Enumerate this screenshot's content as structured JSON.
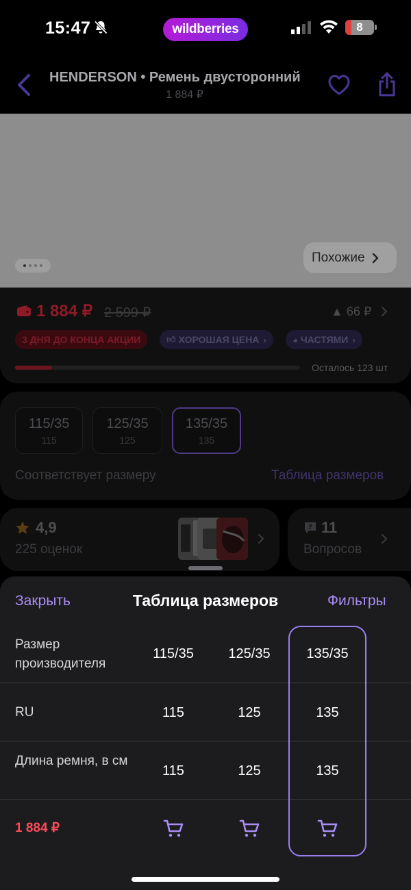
{
  "status_bar": {
    "time": "15:47",
    "brand": "wildberries",
    "battery": "8"
  },
  "header": {
    "title": "HENDERSON • Ремень двусторонний",
    "price": "1 884 ₽"
  },
  "gallery": {
    "similar_label": "Похожие",
    "current_photo": 1,
    "photo_count": 4
  },
  "price": {
    "current": "1 884 ₽",
    "old": "2 599 ₽",
    "change": "▲ 66 ₽",
    "badges": {
      "promo": "3 ДНЯ ДО КОНЦА АКЦИИ",
      "good_price": "ХОРОШАЯ ЦЕНА",
      "installments": "ЧАСТЯМИ"
    },
    "stock_label": "Осталось 123 шт",
    "stock_fraction": 0.13
  },
  "sizes": {
    "options": [
      {
        "name": "115/35",
        "ru": "115"
      },
      {
        "name": "125/35",
        "ru": "125"
      },
      {
        "name": "135/35",
        "ru": "135"
      }
    ],
    "selected": "135/35",
    "fit_text": "Соответствует размеру",
    "table_link": "Таблица размеров"
  },
  "reviews": {
    "rating": "4,9",
    "count_label": "225 оценок"
  },
  "questions": {
    "count": "11",
    "label": "Вопросов"
  },
  "size_table": {
    "close_label": "Закрыть",
    "title": "Таблица размеров",
    "filters_label": "Фильтры",
    "rows": [
      {
        "label": "Размер производителя",
        "values": [
          "115/35",
          "125/35",
          "135/35"
        ]
      },
      {
        "label": "RU",
        "values": [
          "115",
          "125",
          "135"
        ]
      },
      {
        "label": "Длина ремня, в см",
        "values": [
          "115",
          "125",
          "135"
        ]
      }
    ],
    "price_label": "1 884 ₽",
    "highlighted_column": "135/35"
  },
  "colors": {
    "accent": "#9a7ff0",
    "price_red": "#ff4a5a",
    "sheet_bg": "#1c1c1e",
    "brand_gradient": [
      "#b31bd6",
      "#7a2de0"
    ]
  }
}
